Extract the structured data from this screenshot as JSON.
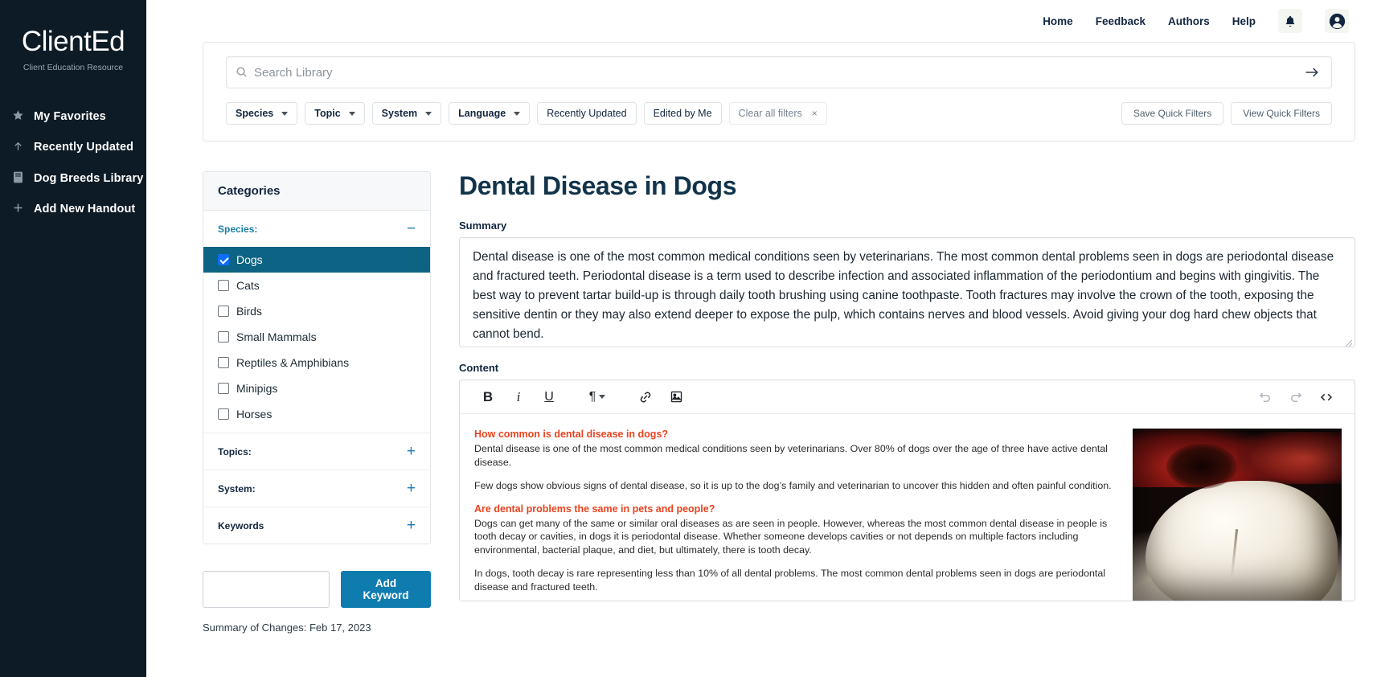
{
  "sidebar": {
    "brand": "ClientEd",
    "tagline": "Client Education Resource",
    "items": [
      {
        "label": "My Favorites",
        "icon": "star-icon"
      },
      {
        "label": "Recently Updated",
        "icon": "arrow-up-icon"
      },
      {
        "label": "Dog Breeds Library",
        "icon": "book-icon"
      },
      {
        "label": "Add New Handout",
        "icon": "plus-icon"
      }
    ]
  },
  "topnav": {
    "links": [
      "Home",
      "Feedback",
      "Authors",
      "Help"
    ],
    "notifications_icon": "bell-icon",
    "account_icon": "user-avatar-icon"
  },
  "search": {
    "placeholder": "Search Library",
    "value": "",
    "submit_icon": "arrow-right-icon",
    "magnifier_icon": "search-icon"
  },
  "filters": {
    "dropdowns": [
      "Species",
      "Topic",
      "System",
      "Language"
    ],
    "toggles": [
      "Recently Updated",
      "Edited by Me"
    ],
    "clear_label": "Clear all filters",
    "clear_x": "×",
    "save_quick_filters": "Save Quick Filters",
    "view_quick_filters": "View Quick Filters"
  },
  "categories": {
    "title": "Categories",
    "sections": [
      {
        "label": "Species:",
        "sign": "−",
        "expanded": true,
        "active": true
      },
      {
        "label": "Topics:",
        "sign": "+",
        "expanded": false,
        "active": false
      },
      {
        "label": "System:",
        "sign": "+",
        "expanded": false,
        "active": false
      },
      {
        "label": "Keywords",
        "sign": "+",
        "expanded": false,
        "active": false
      }
    ],
    "species_options": [
      {
        "label": "Dogs",
        "checked": true
      },
      {
        "label": "Cats",
        "checked": false
      },
      {
        "label": "Birds",
        "checked": false
      },
      {
        "label": "Small Mammals",
        "checked": false
      },
      {
        "label": "Reptiles & Amphibians",
        "checked": false
      },
      {
        "label": "Minipigs",
        "checked": false
      },
      {
        "label": "Horses",
        "checked": false
      }
    ],
    "keyword_input_value": "",
    "add_keyword_label": "Add Keyword",
    "summary_of_changes": "Summary of Changes: Feb 17, 2023"
  },
  "document": {
    "title": "Dental Disease in Dogs",
    "summary_label": "Summary",
    "summary_text": "Dental disease is one of the most common medical conditions seen by veterinarians. The most common dental problems seen in dogs are periodontal disease and fractured teeth. Periodontal disease is a term used to describe infection and associated inflammation of the periodontium and begins with gingivitis. The best way to prevent tartar build-up is through daily tooth brushing using canine toothpaste. Tooth fractures may involve the crown of the tooth, exposing the sensitive dentin or they may also extend deeper to expose the pulp, which contains nerves and blood vessels. Avoid giving your dog hard chew objects that cannot bend.",
    "content_label": "Content",
    "toolbar": {
      "bold": "B",
      "italic": "i",
      "underline": "U",
      "paragraph": "¶",
      "link_icon": "link-icon",
      "image_icon": "image-icon",
      "undo_icon": "undo-icon",
      "redo_icon": "redo-icon",
      "source_icon": "source-code-icon"
    },
    "body_blocks": [
      {
        "type": "heading",
        "text": "How common is dental disease in dogs?"
      },
      {
        "type": "paragraph",
        "text": "Dental disease is one of the most common medical conditions seen by veterinarians. Over 80% of dogs over the age of three have active dental disease."
      },
      {
        "type": "paragraph",
        "text": "Few dogs show obvious signs of dental disease, so it is up to the dog’s family and veterinarian to uncover this hidden and often painful condition."
      },
      {
        "type": "heading",
        "text": "Are dental problems the same in pets and people?"
      },
      {
        "type": "paragraph",
        "text": "Dogs can get many of the same or similar oral diseases as are seen in people. However, whereas the most common dental disease in people is tooth decay or cavities, in dogs it is periodontal disease. Whether someone develops cavities or not depends on multiple factors including environmental, bacterial plaque, and diet, but ultimately, there is tooth decay."
      },
      {
        "type": "paragraph",
        "text": "In dogs, tooth decay is rare representing less than 10% of all dental problems. The most common dental problems seen in dogs are periodontal disease and fractured teeth."
      }
    ],
    "body_image_alt": "fractured-tooth-photo"
  },
  "colors": {
    "sidebar_bg": "#0d1b26",
    "accent_blue": "#0d6383",
    "link_blue": "#1b78b3",
    "heading_red": "#e8431f",
    "title_navy": "#12344b"
  }
}
